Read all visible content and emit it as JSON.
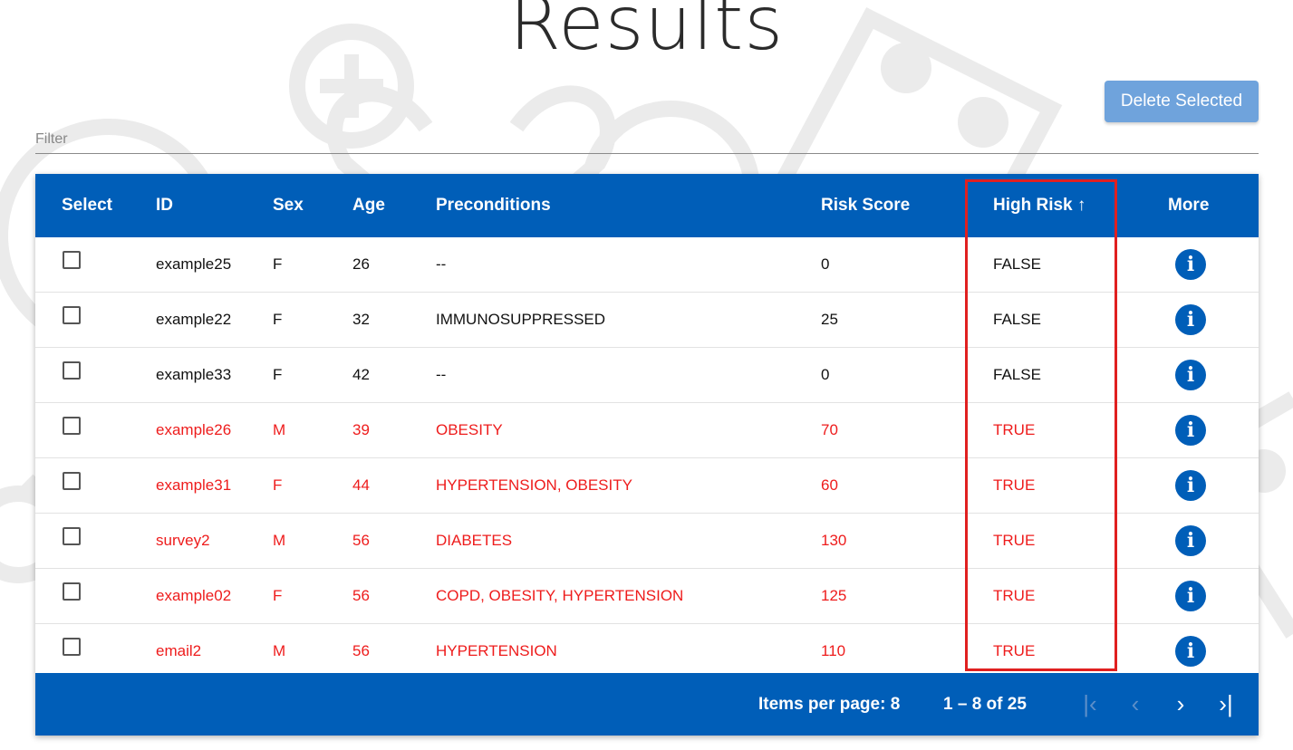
{
  "page": {
    "title": "Results"
  },
  "actions": {
    "delete_label": "Delete Selected"
  },
  "filter": {
    "placeholder": "Filter",
    "value": ""
  },
  "table": {
    "headers": {
      "select": "Select",
      "id": "ID",
      "sex": "Sex",
      "age": "Age",
      "preconditions": "Preconditions",
      "risk_score": "Risk Score",
      "high_risk": "High Risk",
      "sort_indicator": "↑",
      "more": "More"
    },
    "rows": [
      {
        "id": "example25",
        "sex": "F",
        "age": "26",
        "preconditions": "--",
        "risk_score": "0",
        "high_risk": "FALSE"
      },
      {
        "id": "example22",
        "sex": "F",
        "age": "32",
        "preconditions": "IMMUNOSUPPRESSED",
        "risk_score": "25",
        "high_risk": "FALSE"
      },
      {
        "id": "example33",
        "sex": "F",
        "age": "42",
        "preconditions": "--",
        "risk_score": "0",
        "high_risk": "FALSE"
      },
      {
        "id": "example26",
        "sex": "M",
        "age": "39",
        "preconditions": "OBESITY",
        "risk_score": "70",
        "high_risk": "TRUE"
      },
      {
        "id": "example31",
        "sex": "F",
        "age": "44",
        "preconditions": "HYPERTENSION, OBESITY",
        "risk_score": "60",
        "high_risk": "TRUE"
      },
      {
        "id": "survey2",
        "sex": "M",
        "age": "56",
        "preconditions": "DIABETES",
        "risk_score": "130",
        "high_risk": "TRUE"
      },
      {
        "id": "example02",
        "sex": "F",
        "age": "56",
        "preconditions": "COPD, OBESITY, HYPERTENSION",
        "risk_score": "125",
        "high_risk": "TRUE"
      },
      {
        "id": "email2",
        "sex": "M",
        "age": "56",
        "preconditions": "HYPERTENSION",
        "risk_score": "110",
        "high_risk": "TRUE"
      }
    ]
  },
  "paginator": {
    "items_per_page": "Items per page: 8",
    "range": "1 – 8 of 25",
    "first_icon": "first-page-icon",
    "prev_icon": "chevron-left-icon",
    "next_icon": "chevron-right-icon",
    "last_icon": "last-page-icon"
  },
  "colors": {
    "primary": "#005eb8",
    "high_risk_text": "#ee1c1c",
    "button": "#6fa3dc",
    "highlight_box": "#e02020"
  }
}
